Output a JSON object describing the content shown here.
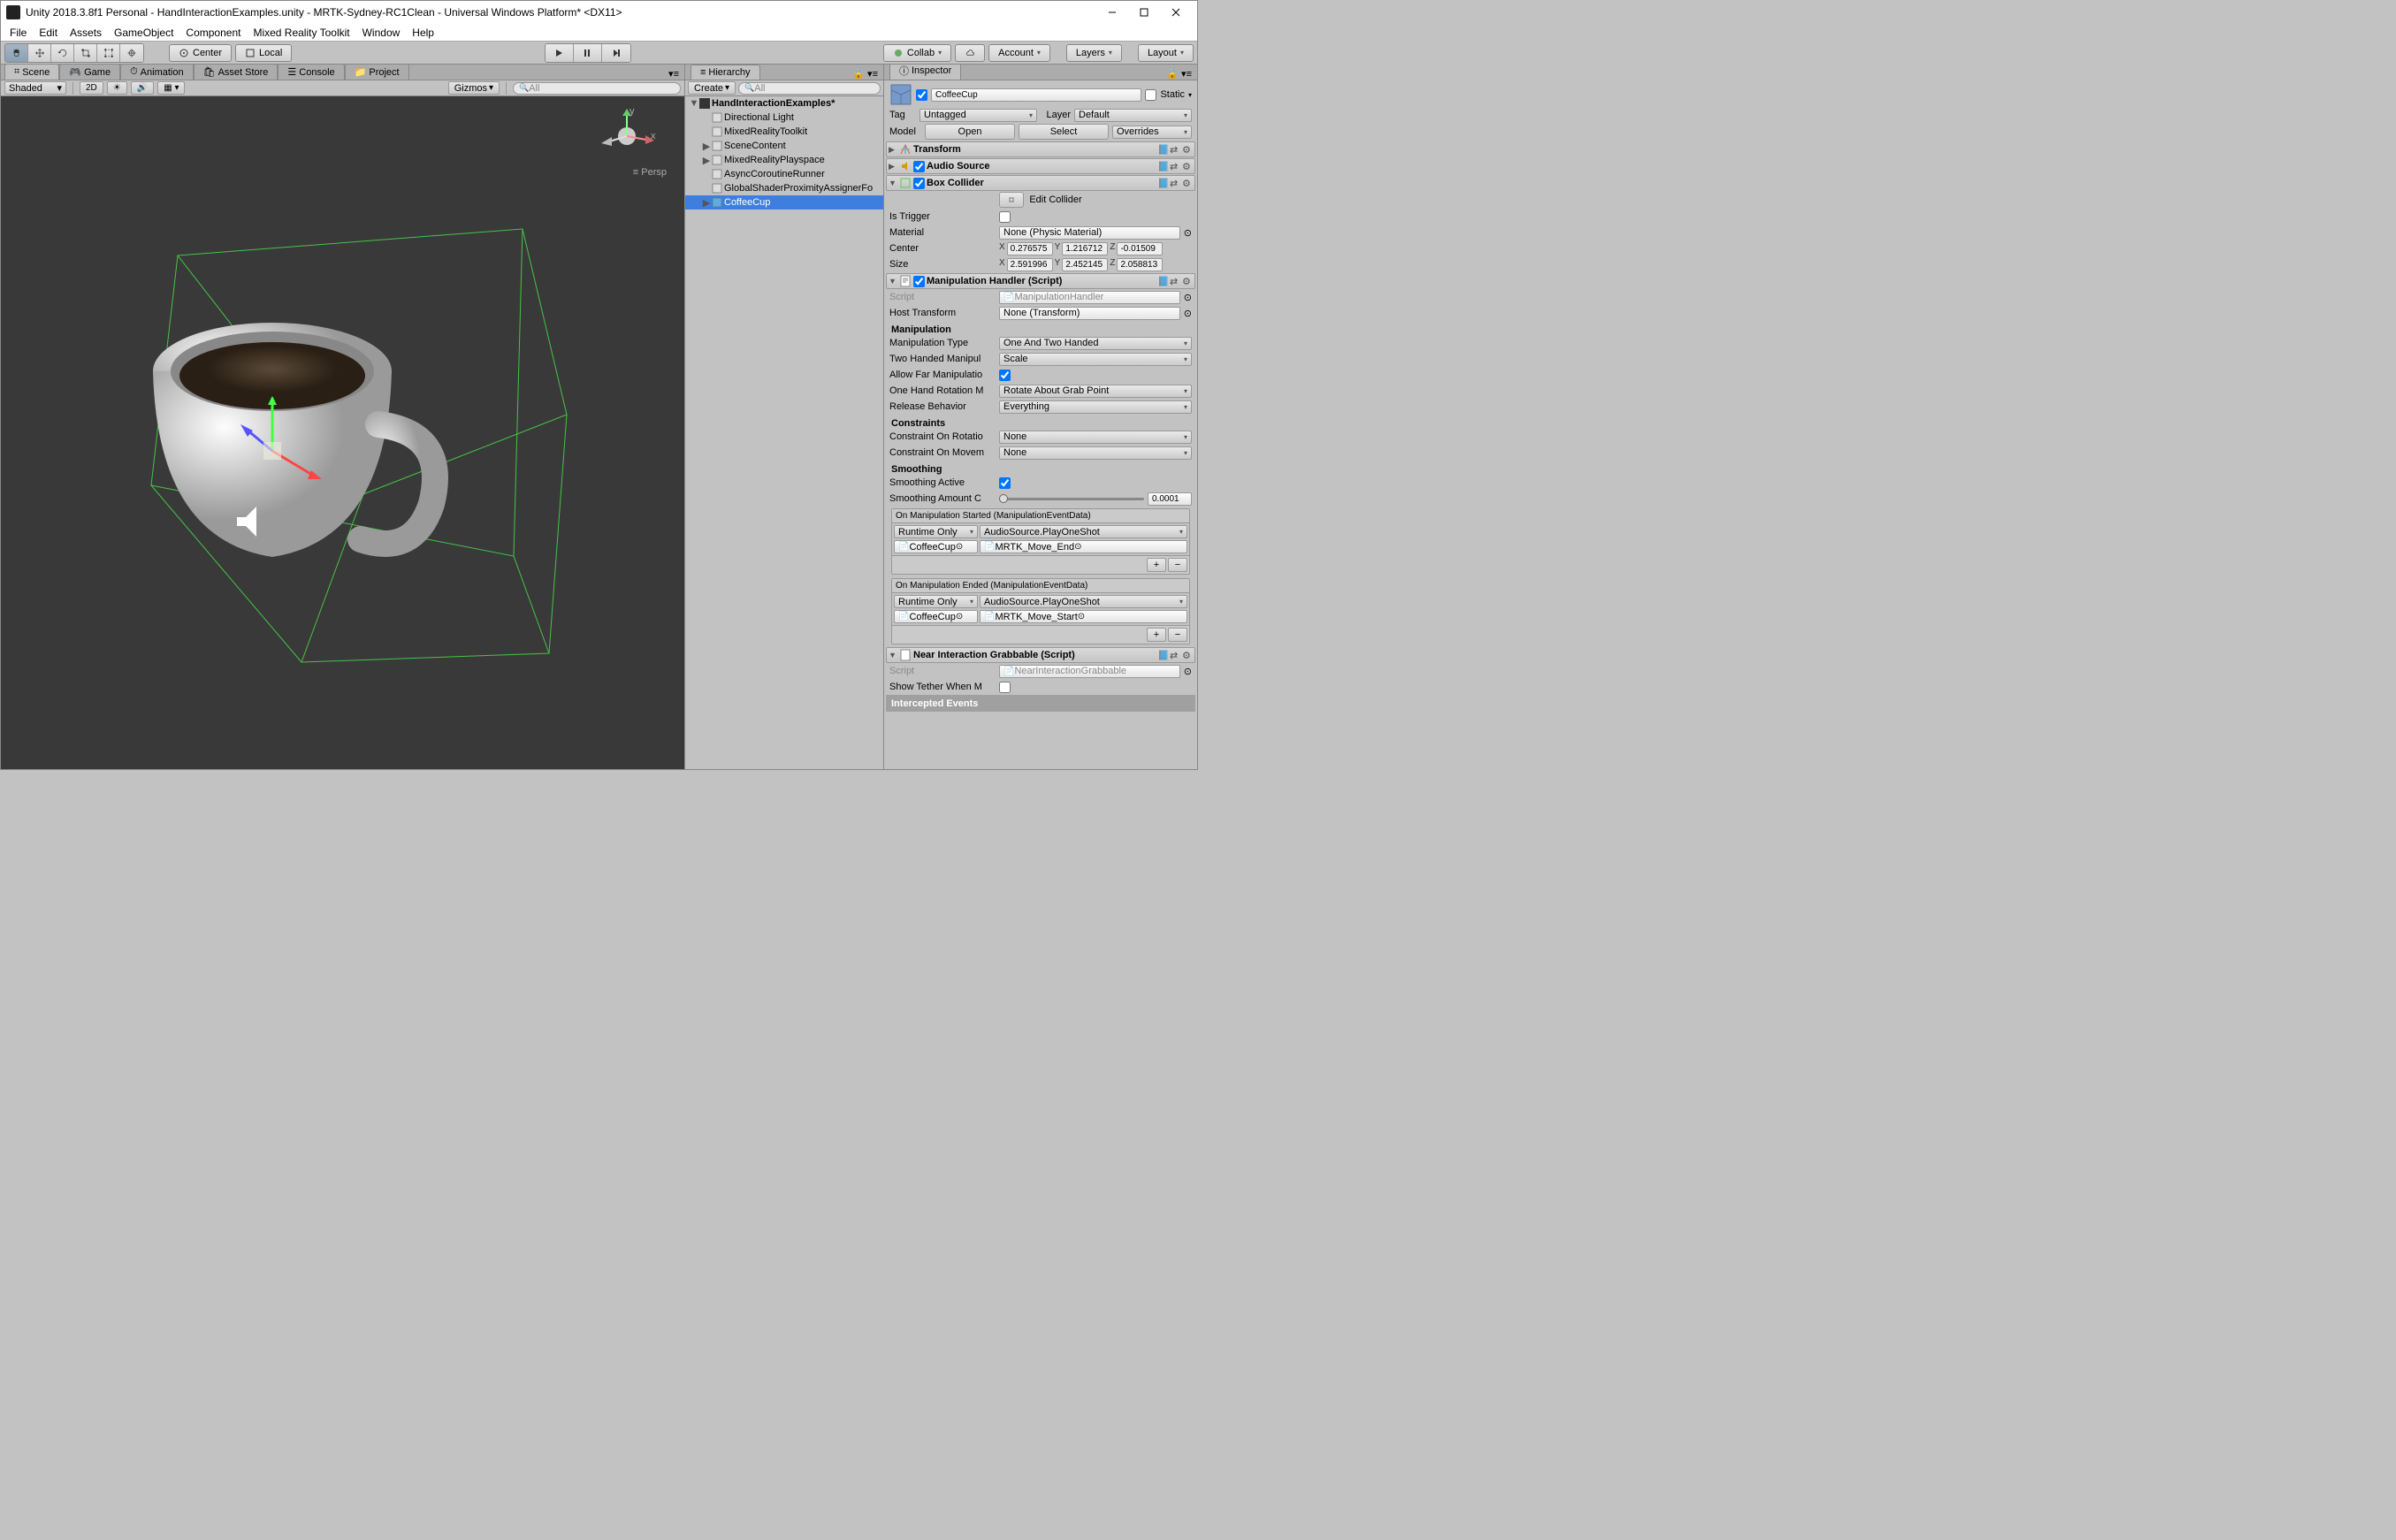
{
  "window": {
    "title": "Unity 2018.3.8f1 Personal - HandInteractionExamples.unity - MRTK-Sydney-RC1Clean - Universal Windows Platform* <DX11>"
  },
  "menu": [
    "File",
    "Edit",
    "Assets",
    "GameObject",
    "Component",
    "Mixed Reality Toolkit",
    "Window",
    "Help"
  ],
  "toolbar": {
    "center": "Center",
    "local": "Local",
    "collab": "Collab",
    "account": "Account",
    "layers": "Layers",
    "layout": "Layout"
  },
  "tabs": {
    "scene": "Scene",
    "game": "Game",
    "animation": "Animation",
    "assetstore": "Asset Store",
    "console": "Console",
    "project": "Project"
  },
  "sceneToolbar": {
    "shaded": "Shaded",
    "twoD": "2D",
    "gizmos": "Gizmos",
    "searchAll": "All",
    "persp": "Persp"
  },
  "hierarchy": {
    "title": "Hierarchy",
    "create": "Create",
    "searchAll": "All",
    "root": "HandInteractionExamples*",
    "items": [
      "Directional Light",
      "MixedRealityToolkit",
      "SceneContent",
      "MixedRealityPlayspace",
      "AsyncCoroutineRunner",
      "GlobalShaderProximityAssignerFo"
    ],
    "selected": "CoffeeCup"
  },
  "inspector": {
    "title": "Inspector",
    "name": "CoffeeCup",
    "static": "Static",
    "tag": "Tag",
    "tagValue": "Untagged",
    "layer": "Layer",
    "layerValue": "Default",
    "model": "Model",
    "open": "Open",
    "select": "Select",
    "overrides": "Overrides",
    "transform": "Transform",
    "audioSource": "Audio Source",
    "boxCollider": {
      "name": "Box Collider",
      "editCollider": "Edit Collider",
      "isTrigger": "Is Trigger",
      "material": "Material",
      "materialValue": "None (Physic Material)",
      "center": "Center",
      "centerX": "0.276575",
      "centerY": "1.216712",
      "centerZ": "-0.01509",
      "size": "Size",
      "sizeX": "2.591996",
      "sizeY": "2.452145",
      "sizeZ": "2.058813"
    },
    "manipHandler": {
      "name": "Manipulation Handler (Script)",
      "script": "Script",
      "scriptValue": "ManipulationHandler",
      "hostTransform": "Host Transform",
      "hostTransformValue": "None (Transform)",
      "manipulation": "Manipulation",
      "manipType": "Manipulation Type",
      "manipTypeValue": "One And Two Handed",
      "twoHanded": "Two Handed Manipul",
      "twoHandedValue": "Scale",
      "allowFar": "Allow Far Manipulatio",
      "oneHandRot": "One Hand Rotation M",
      "oneHandRotValue": "Rotate About Grab Point",
      "releaseBehavior": "Release Behavior",
      "releaseBehaviorValue": "Everything",
      "constraints": "Constraints",
      "constraintRotation": "Constraint On Rotatio",
      "constraintRotationValue": "None",
      "constraintMovement": "Constraint On Movem",
      "constraintMovementValue": "None",
      "smoothing": "Smoothing",
      "smoothingActive": "Smoothing Active",
      "smoothingAmount": "Smoothing Amount C",
      "smoothingAmountValue": "0.0001",
      "onManipStarted": "On Manipulation Started (ManipulationEventData)",
      "onManipEnded": "On Manipulation Ended (ManipulationEventData)",
      "runtimeOnly": "Runtime Only",
      "audioPlayOneShot": "AudioSource.PlayOneShot",
      "coffeeCup": "CoffeeCup",
      "moveEnd": "MRTK_Move_End",
      "moveStart": "MRTK_Move_Start"
    },
    "nearInteraction": {
      "name": "Near Interaction Grabbable (Script)",
      "script": "Script",
      "scriptValue": "NearInteractionGrabbable",
      "showTether": "Show Tether When M"
    },
    "interceptedEvents": "Intercepted Events"
  }
}
